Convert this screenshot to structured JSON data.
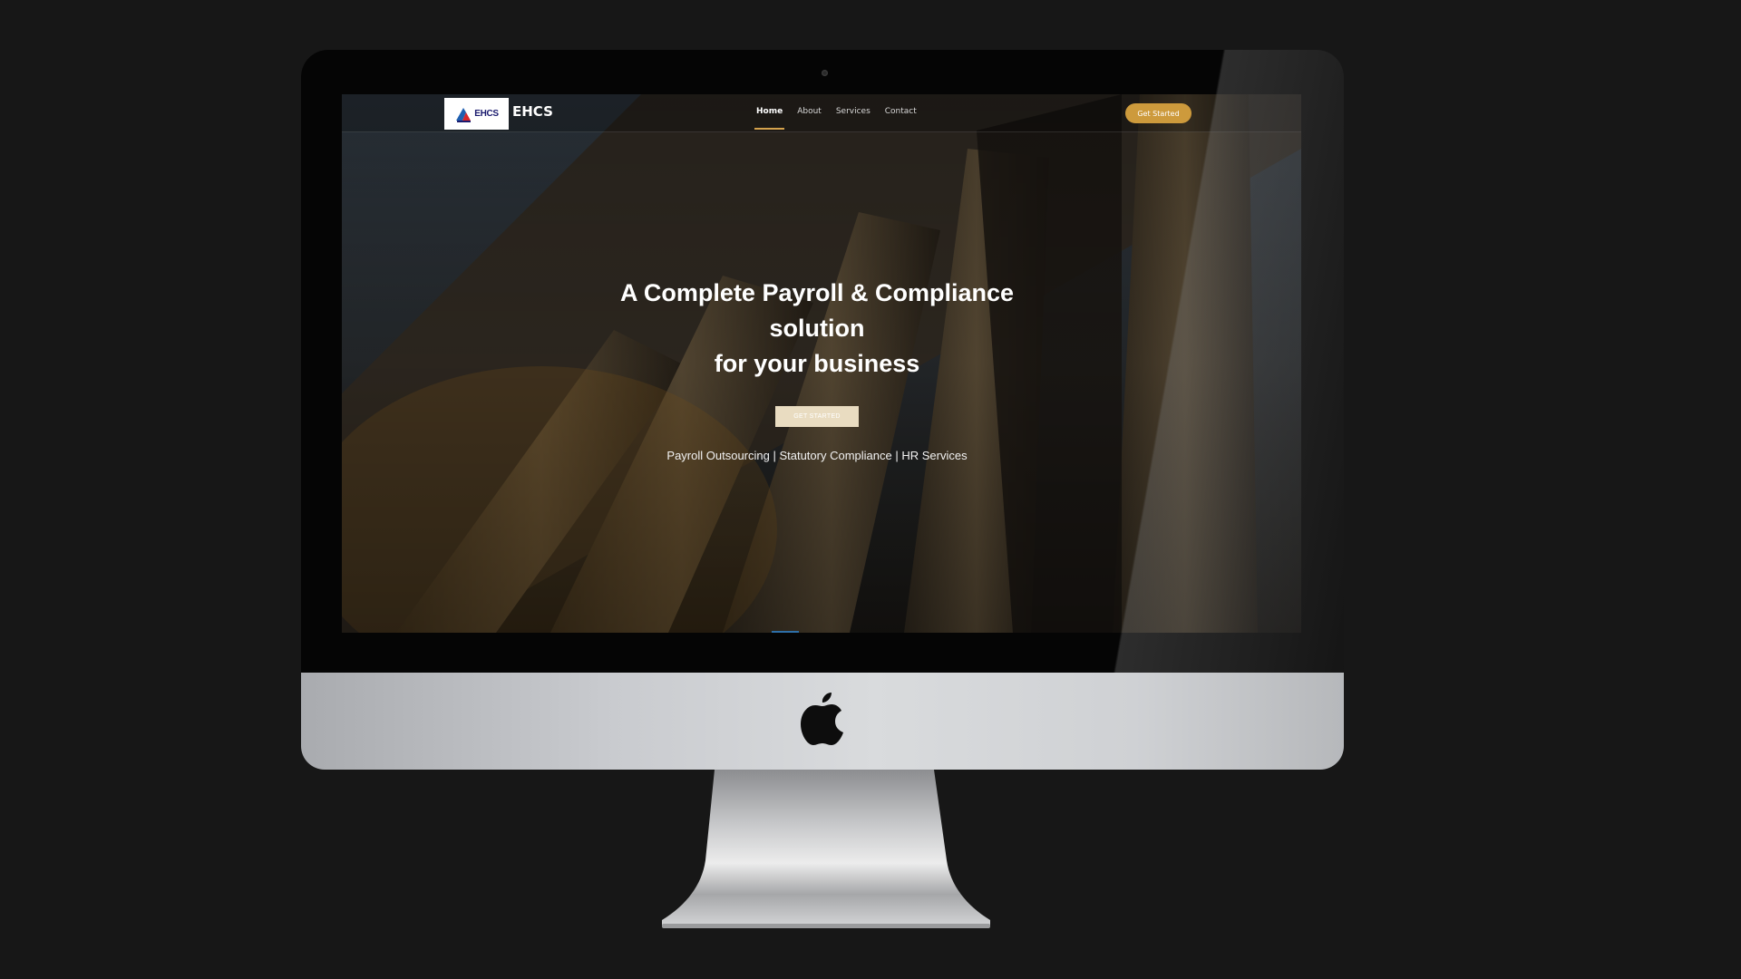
{
  "site": {
    "logo_text": "EHCS",
    "brand_name": "EHCS",
    "nav": [
      {
        "label": "Home",
        "active": true
      },
      {
        "label": "About",
        "active": false
      },
      {
        "label": "Services",
        "active": false
      },
      {
        "label": "Contact",
        "active": false
      }
    ],
    "header_cta": "Get Started"
  },
  "hero": {
    "title_lines": [
      "A Complete Payroll & Compliance",
      "solution",
      "for your business"
    ],
    "cta": "GET STARTED",
    "subtitle": "Payroll Outsourcing | Statutory Compliance | HR Services"
  },
  "colors": {
    "accent": "#cd9a3c",
    "background": "#171717",
    "bezel": "#050505",
    "chin": "#c9cbcf"
  },
  "icons": {
    "device_logo": "apple-logo-icon",
    "site_logo": "ehcs-logo-icon",
    "camera": "camera-icon"
  }
}
